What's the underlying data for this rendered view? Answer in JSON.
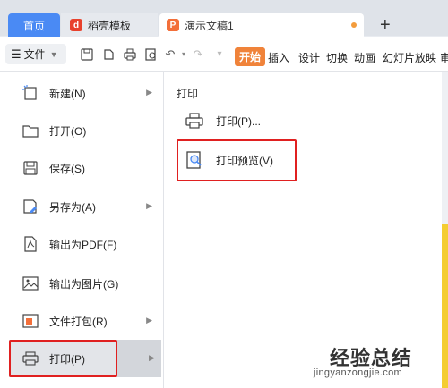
{
  "tabs": {
    "home": "首页",
    "daoke": "稻壳模板",
    "doc": "演示文稿1",
    "add": "+"
  },
  "toolbar": {
    "file_label": "文件",
    "ribbon_active": "开始",
    "ribbon": [
      "插入",
      "设计",
      "切换",
      "动画",
      "幻灯片放映",
      "审"
    ]
  },
  "file_menu": {
    "items": [
      {
        "label": "新建(N)",
        "icon": "new-icon",
        "has_arrow": true
      },
      {
        "label": "打开(O)",
        "icon": "folder-icon",
        "has_arrow": false
      },
      {
        "label": "保存(S)",
        "icon": "save-icon",
        "has_arrow": false
      },
      {
        "label": "另存为(A)",
        "icon": "save-as-icon",
        "has_arrow": true
      },
      {
        "label": "输出为PDF(F)",
        "icon": "pdf-icon",
        "has_arrow": false
      },
      {
        "label": "输出为图片(G)",
        "icon": "image-icon",
        "has_arrow": false
      },
      {
        "label": "文件打包(R)",
        "icon": "package-icon",
        "has_arrow": true
      },
      {
        "label": "打印(P)",
        "icon": "printer-icon",
        "has_arrow": true,
        "selected": true
      }
    ]
  },
  "print_submenu": {
    "header": "打印",
    "items": [
      {
        "label": "打印(P)...",
        "icon": "printer-icon"
      },
      {
        "label": "打印预览(V)",
        "icon": "print-preview-icon",
        "highlighted": true
      }
    ]
  },
  "watermark": {
    "cn": "经验总结",
    "url": "jingyanzongjie.com"
  },
  "colors": {
    "accent_blue": "#4a8af4",
    "accent_orange": "#f0833a",
    "highlight_red": "#e02020"
  }
}
